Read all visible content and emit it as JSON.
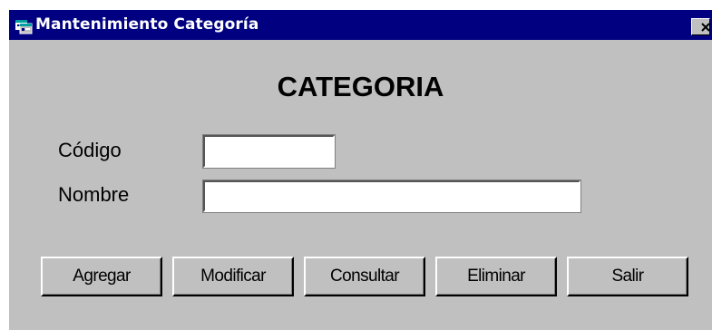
{
  "window": {
    "title": "Mantenimiento Categoría",
    "icon": "app-window-icon",
    "close_icon": "close-x-icon"
  },
  "form": {
    "heading": "CATEGORIA",
    "fields": [
      {
        "label": "Código",
        "value": "",
        "placeholder": ""
      },
      {
        "label": "Nombre",
        "value": "",
        "placeholder": ""
      }
    ]
  },
  "buttons": [
    {
      "label": "Agregar"
    },
    {
      "label": "Modificar"
    },
    {
      "label": "Consultar"
    },
    {
      "label": "Eliminar"
    },
    {
      "label": "Salir"
    }
  ],
  "colors": {
    "titlebar": "#000080",
    "window_bg": "#c0c0c0",
    "title_text": "#ffffff"
  }
}
